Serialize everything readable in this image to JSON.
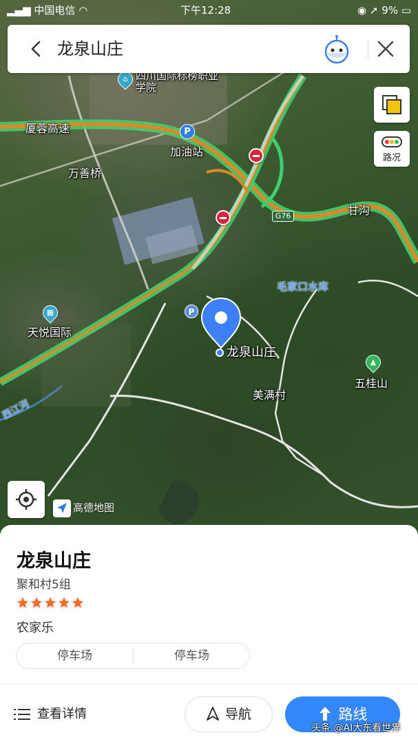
{
  "status_bar": {
    "carrier": "中国电信",
    "time": "下午12:28",
    "battery": "9%"
  },
  "search": {
    "query": "龙泉山庄",
    "back_icon": "back-arrow-icon",
    "assistant_icon": "assistant-robot-icon",
    "close_icon": "close-icon"
  },
  "map": {
    "labels": {
      "school": "四川国际标榜职业学院",
      "highway": "厦蓉高速",
      "gas_station": "加油站",
      "wanshan_bridge": "万善桥",
      "g76": "G76",
      "gangou": "甘沟",
      "reservoir": "毛家口水库",
      "tianyue": "天悦国际",
      "destination": "龙泉山庄",
      "meiman": "美满村",
      "wuguishan": "五桂山",
      "xijiang": "西江河"
    },
    "traffic_label": "路况",
    "logo_text": "高德地图"
  },
  "place": {
    "name": "龙泉山庄",
    "address": "聚和村5组",
    "rating": 5,
    "category": "农家乐",
    "tags": [
      "停车场",
      "停车场"
    ]
  },
  "actions": {
    "details": "查看详情",
    "navigate": "导航",
    "route": "路线"
  },
  "watermark": "头条 @AI大东看世界",
  "colors": {
    "accent": "#3487f8",
    "star": "#ff6a2b",
    "highway_orange": "#d98a2a",
    "highway_green": "#3fcf6f"
  }
}
